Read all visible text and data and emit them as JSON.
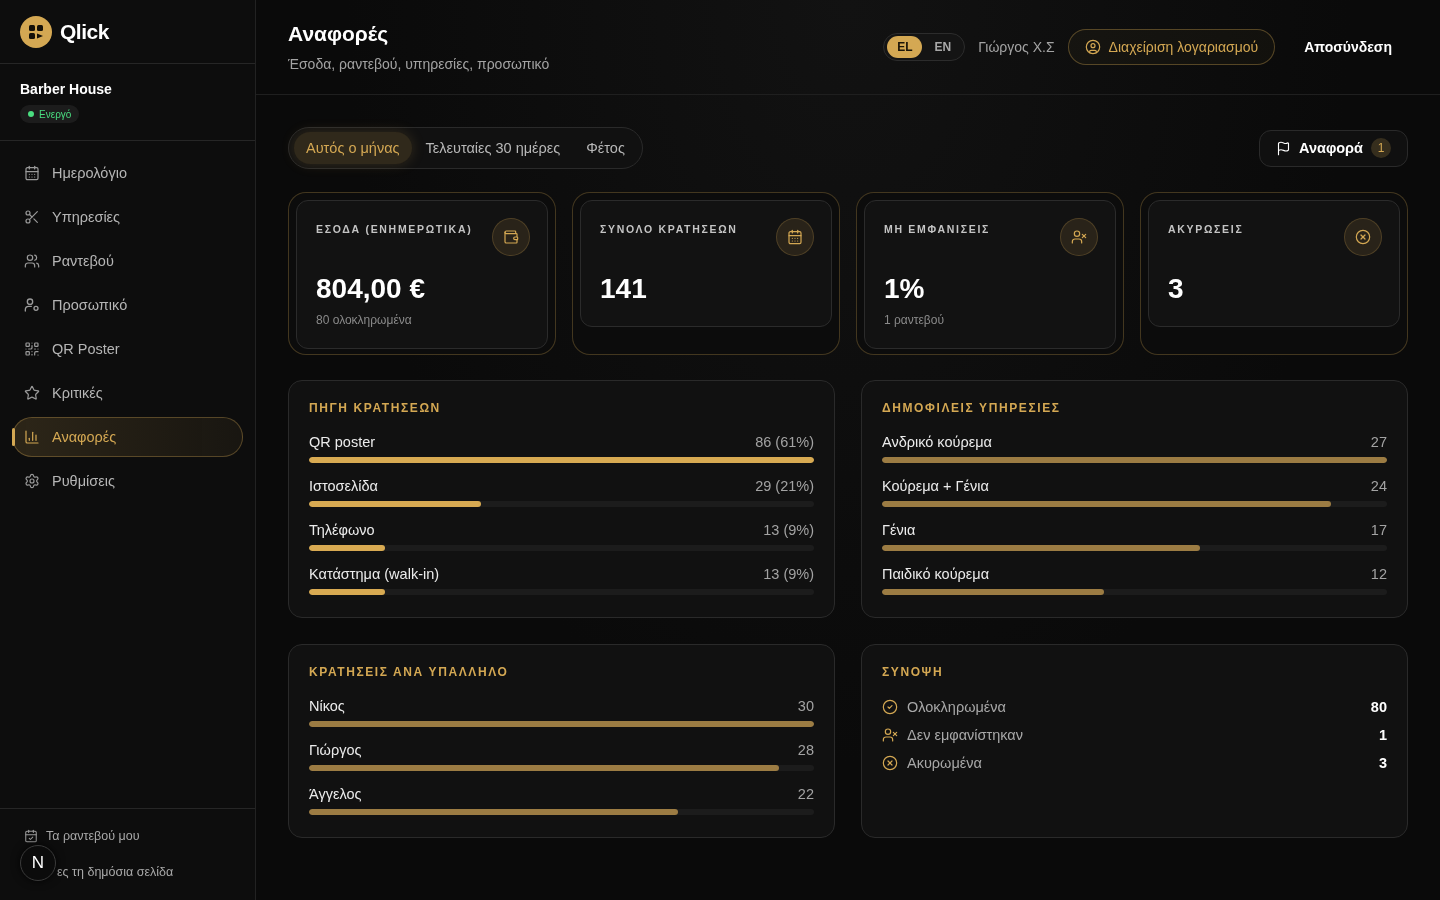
{
  "sidebar": {
    "brand": "Qlick",
    "business": {
      "name": "Barber House",
      "status": {
        "label": "Ενεργό",
        "active": true
      }
    },
    "nav": [
      {
        "label": "Ημερολόγιο",
        "selected": false
      },
      {
        "label": "Υπηρεσίες",
        "selected": false
      },
      {
        "label": "Ραντεβού",
        "selected": false
      },
      {
        "label": "Προσωπικό",
        "selected": false
      },
      {
        "label": "QR Poster",
        "selected": false
      },
      {
        "label": "Κριτικές",
        "selected": false
      },
      {
        "label": "Αναφορές",
        "selected": true
      },
      {
        "label": "Ρυθμίσεις",
        "selected": false
      }
    ],
    "footer_links": [
      "Τα ραντεβού μου",
      "ες τη δημόσια σελίδα"
    ]
  },
  "dev_badge": "N",
  "header": {
    "title": "Αναφορές",
    "subtitle": "Έσοδα, ραντεβού, υπηρεσίες, προσωπικό",
    "languages": [
      {
        "label": "EL",
        "selected": true
      },
      {
        "label": "EN",
        "selected": false
      }
    ],
    "user_name": "Γιώργος Χ.Σ",
    "account_button": "Διαχείριση λογαριασμού",
    "logout_button": "Αποσύνδεση"
  },
  "toolbar": {
    "periods": [
      {
        "label": "Αυτός ο μήνας",
        "selected": true
      },
      {
        "label": "Τελευταίες 30 ημέρες",
        "selected": false
      },
      {
        "label": "Φέτος",
        "selected": false
      }
    ],
    "report_button": {
      "label": "Αναφορά",
      "count": "1"
    }
  },
  "stats": [
    {
      "label": "ΕΣΟΔΑ (ΕΝΗΜΕΡΩΤΙΚΑ)",
      "value": "804,00 €",
      "note": "80 ολοκληρωμένα"
    },
    {
      "label": "ΣΥΝΟΛΟ ΚΡΑΤΗΣΕΩΝ",
      "value": "141"
    },
    {
      "label": "ΜΗ ΕΜΦΑΝΙΣΕΙΣ",
      "value": "1%",
      "note": "1 ραντεβού"
    },
    {
      "label": "ΑΚΥΡΩΣΕΙΣ",
      "value": "3"
    }
  ],
  "panels": [
    {
      "title": "ΠΗΓΗ ΚΡΑΤΗΣΕΩΝ",
      "highlight": true,
      "rows": [
        {
          "label": "QR poster",
          "value": "86 (61%)",
          "level": 1
        },
        {
          "label": "Ιστοσελίδα",
          "value": "29 (21%)",
          "level": 0.34
        },
        {
          "label": "Τηλέφωνο",
          "value": "13 (9%)",
          "level": 0.15
        },
        {
          "label": "Κατάστημα (walk-in)",
          "value": "13 (9%)",
          "level": 0.15
        }
      ]
    },
    {
      "title": "ΔΗΜΟΦΙΛΕΙΣ ΥΠΗΡΕΣΙΕΣ",
      "highlight": false,
      "rows": [
        {
          "label": "Ανδρικό κούρεμα",
          "value": "27",
          "level": 1
        },
        {
          "label": "Κούρεμα + Γένια",
          "value": "24",
          "level": 0.89
        },
        {
          "label": "Γένια",
          "value": "17",
          "level": 0.63
        },
        {
          "label": "Παιδικό κούρεμα",
          "value": "12",
          "level": 0.44
        }
      ]
    },
    {
      "title": "ΚΡΑΤΗΣΕΙΣ ΑΝΑ ΥΠΑΛΛΗΛΟ",
      "highlight": false,
      "rows": [
        {
          "label": "Νίκος",
          "value": "30",
          "level": 1
        },
        {
          "label": "Γιώργος",
          "value": "28",
          "level": 0.93
        },
        {
          "label": "Άγγελος",
          "value": "22",
          "level": 0.73
        }
      ]
    }
  ],
  "summary": {
    "title": "ΣΥΝΟΨΗ",
    "rows": [
      {
        "label": "Ολοκληρωμένα",
        "value": "80"
      },
      {
        "label": "Δεν εμφανίστηκαν",
        "value": "1"
      },
      {
        "label": "Ακυρωμένα",
        "value": "3"
      }
    ]
  }
}
